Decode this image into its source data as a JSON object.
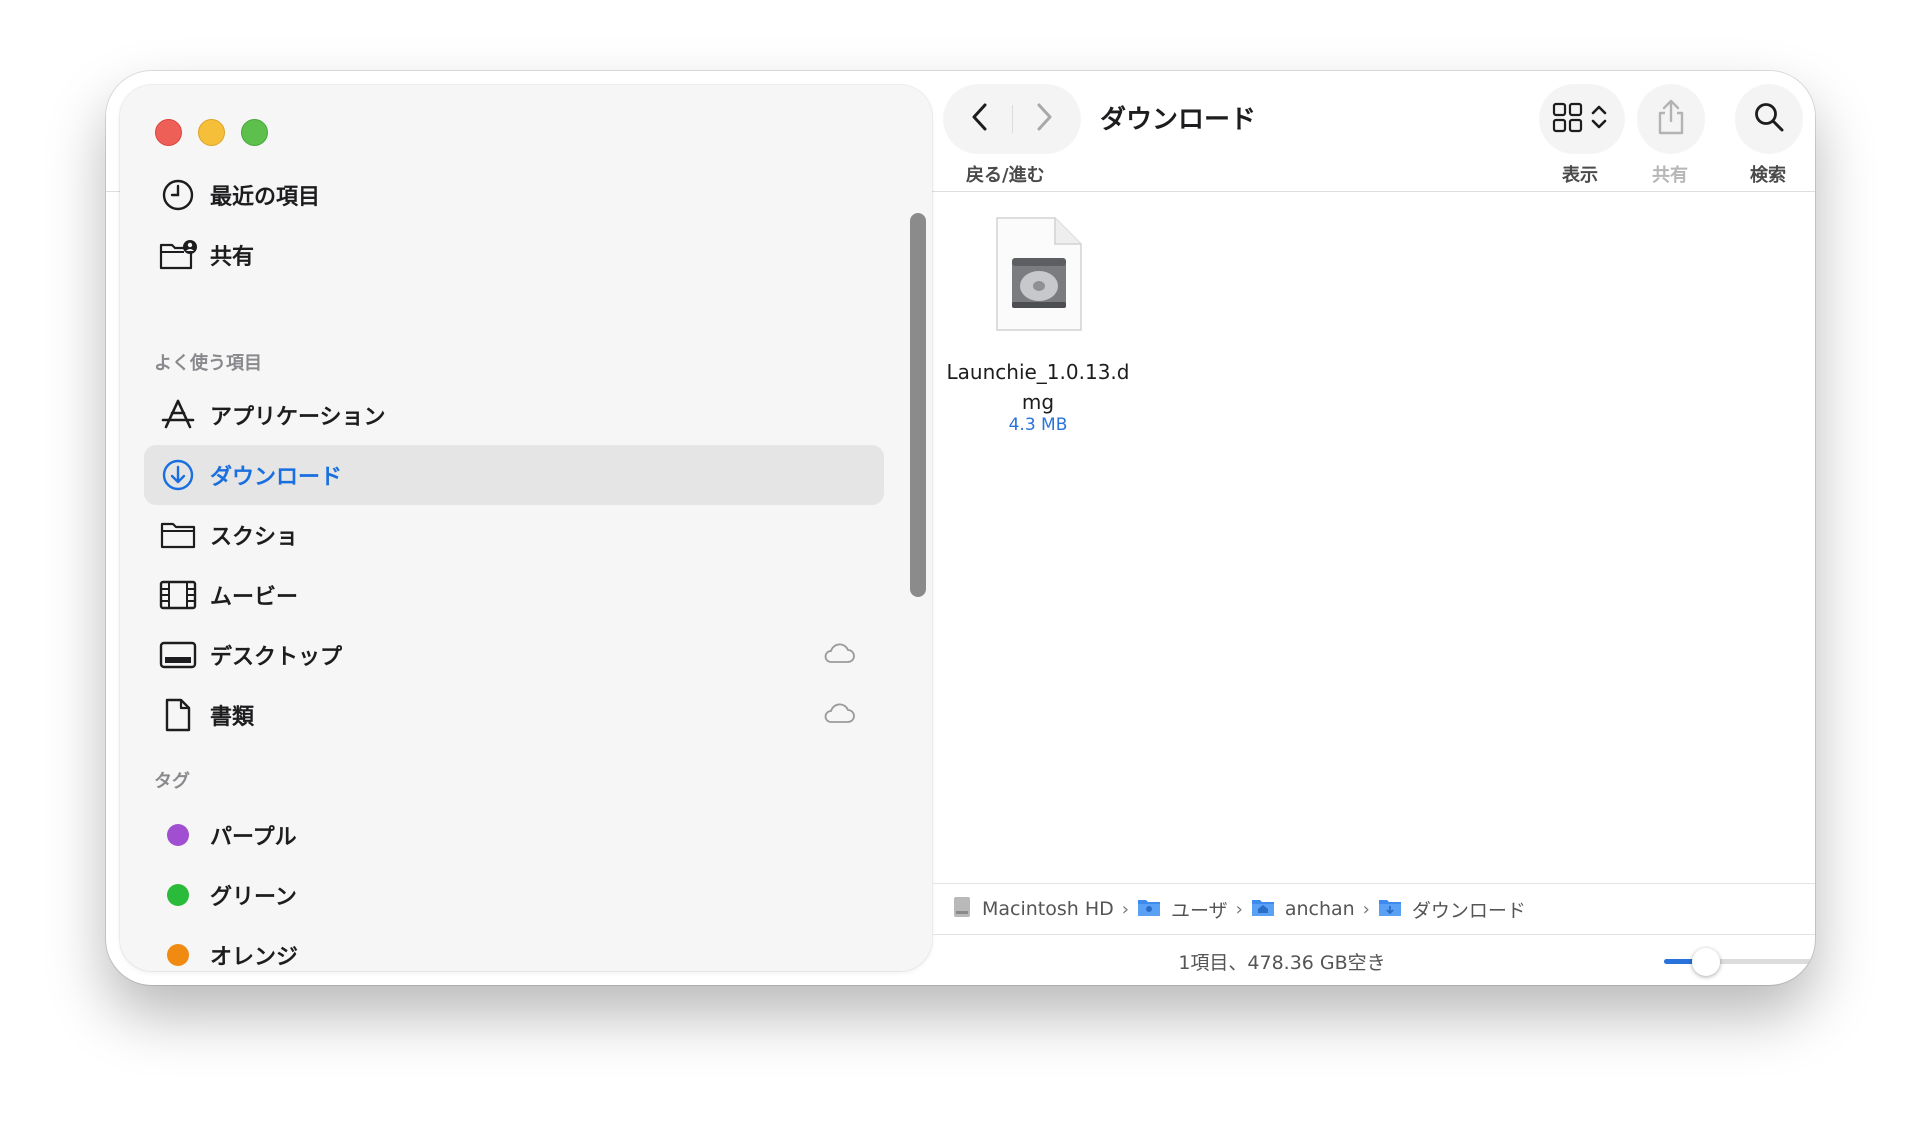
{
  "window": {
    "title": "ダウンロード"
  },
  "toolbar": {
    "back_forward_label": "戻る/進む",
    "view_label": "表示",
    "share_label": "共有",
    "search_label": "検索"
  },
  "sidebar": {
    "top_items": [
      {
        "label": "最近の項目",
        "icon": "clock-icon"
      },
      {
        "label": "共有",
        "icon": "shared-folder-icon"
      }
    ],
    "favorites_header": "よく使う項目",
    "favorites": [
      {
        "label": "アプリケーション",
        "icon": "applications-icon"
      },
      {
        "label": "ダウンロード",
        "icon": "download-icon",
        "selected": true
      },
      {
        "label": "スクショ",
        "icon": "folder-icon"
      },
      {
        "label": "ムービー",
        "icon": "film-icon"
      },
      {
        "label": "デスクトップ",
        "icon": "desktop-icon",
        "cloud": true
      },
      {
        "label": "書類",
        "icon": "document-icon",
        "cloud": true
      }
    ],
    "tags_header": "タグ",
    "tags": [
      {
        "label": "パープル",
        "color": "#a04fd0"
      },
      {
        "label": "グリーン",
        "color": "#2bbb3a"
      },
      {
        "label": "オレンジ",
        "color": "#f08a11"
      }
    ]
  },
  "files": [
    {
      "name": "Launchie_1.0.13.dmg",
      "size": "4.3 MB",
      "icon": "disk-image-icon"
    }
  ],
  "pathbar": {
    "crumbs": [
      "Macintosh HD",
      "ユーザ",
      "anchan",
      "ダウンロード"
    ]
  },
  "statusbar": {
    "text": "1項目、478.36 GB空き",
    "icon_size_slider": 0.2
  },
  "colors": {
    "accent": "#1a6fe0",
    "close": "#ee5f57",
    "minimize": "#f6bf3a",
    "maximize": "#5dc04d"
  }
}
